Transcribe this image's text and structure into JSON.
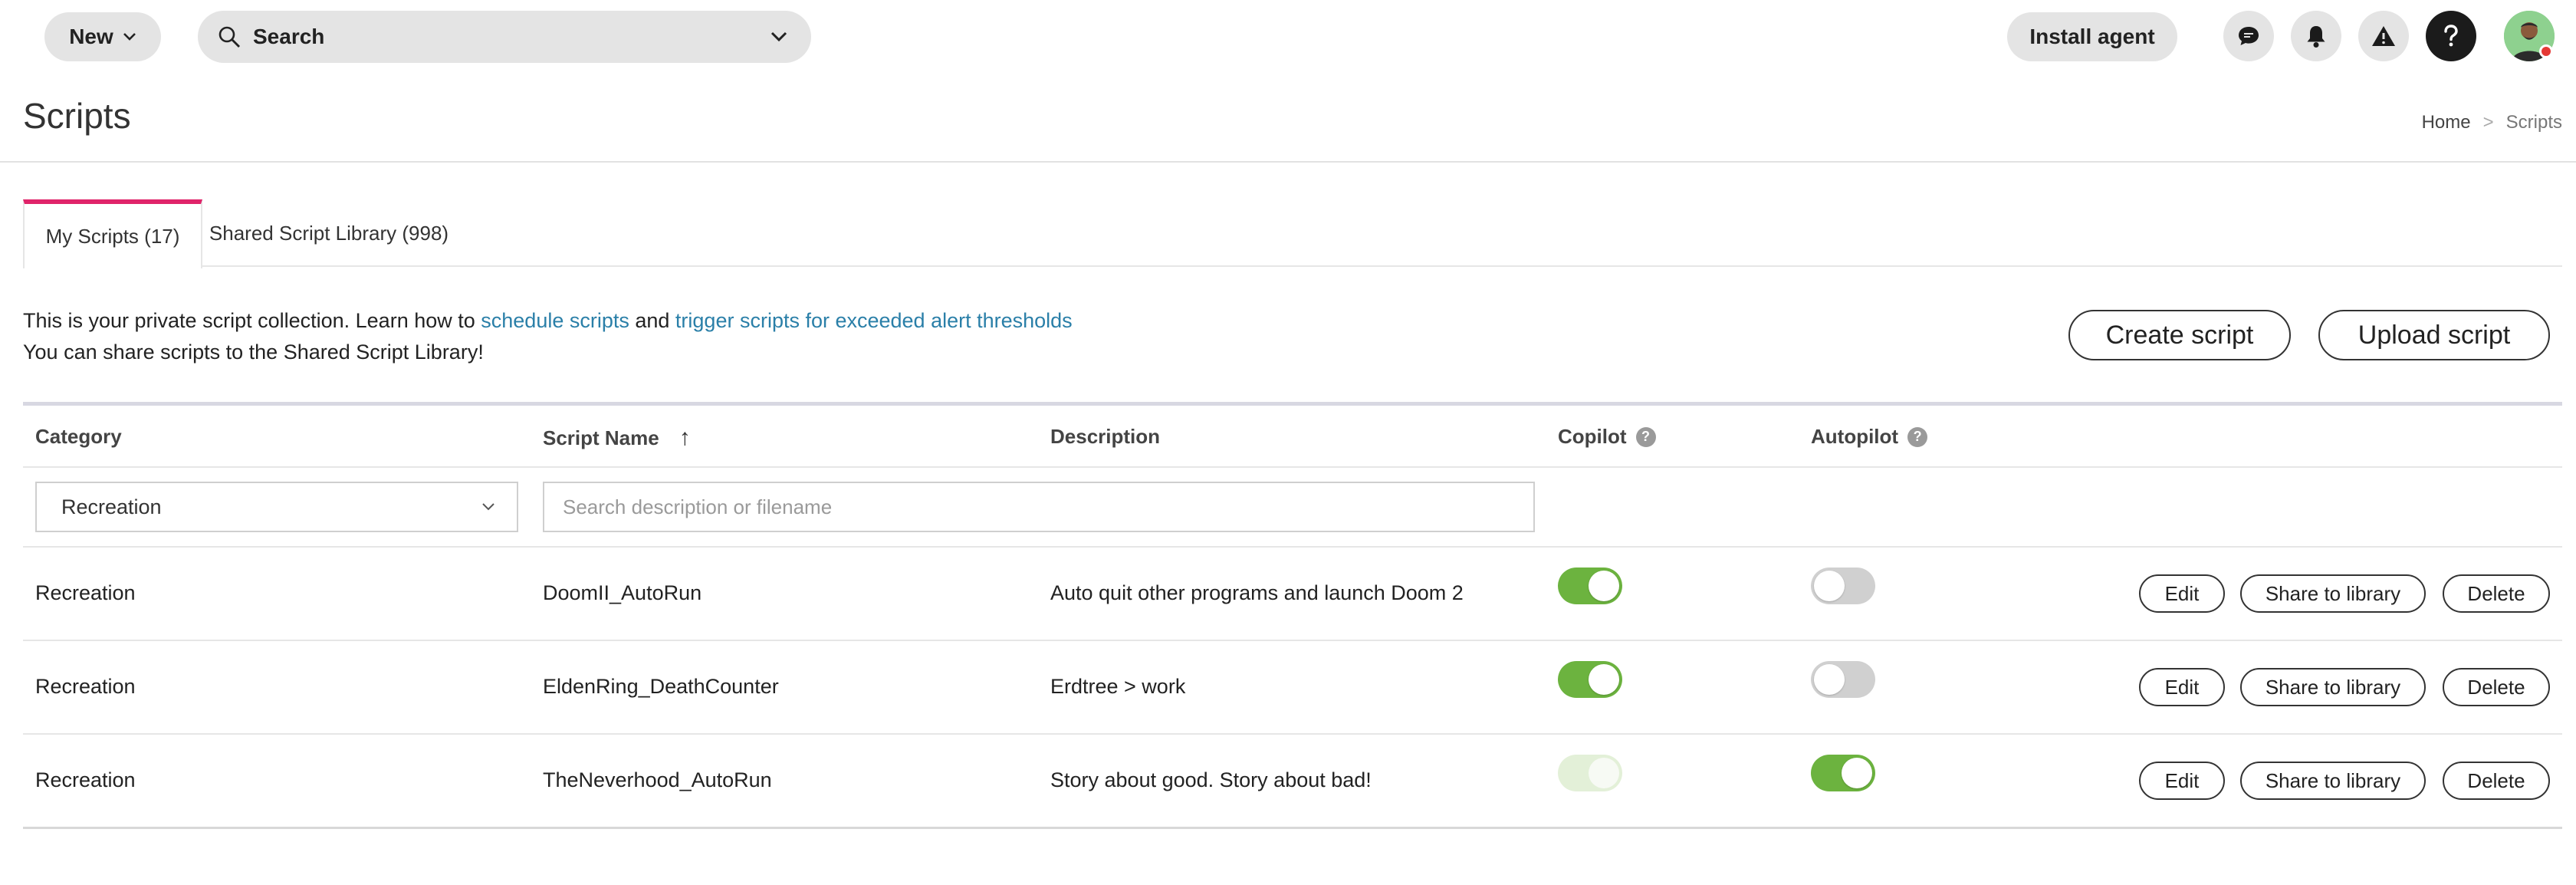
{
  "topbar": {
    "new_label": "New",
    "search_label": "Search",
    "install_label": "Install agent",
    "icons": [
      "chat-icon",
      "bell-icon",
      "warning-icon",
      "help-icon"
    ]
  },
  "header": {
    "title": "Scripts",
    "breadcrumb": {
      "home": "Home",
      "sep": ">",
      "current": "Scripts"
    }
  },
  "tabs": [
    {
      "label": "My Scripts (17)",
      "active": true
    },
    {
      "label": "Shared Script Library (998)",
      "active": false
    }
  ],
  "info": {
    "line1_prefix": "This is your private script collection. Learn how to ",
    "link1": "schedule scripts",
    "line1_mid": " and ",
    "link2": "trigger scripts for exceeded alert thresholds",
    "line2": "You can share scripts to the Shared Script Library!"
  },
  "actions": {
    "create": "Create script",
    "upload": "Upload script"
  },
  "table": {
    "headers": {
      "category": "Category",
      "name": "Script Name",
      "sort_arrow": "↑",
      "description": "Description",
      "copilot": "Copilot",
      "autopilot": "Autopilot",
      "help_glyph": "?"
    },
    "filter": {
      "category_value": "Recreation",
      "search_placeholder": "Search description or filename"
    },
    "row_buttons": {
      "edit": "Edit",
      "share": "Share to library",
      "delete": "Delete"
    },
    "rows": [
      {
        "category": "Recreation",
        "name": "DoomII_AutoRun",
        "description": "Auto quit other programs and launch Doom 2",
        "copilot": "on",
        "autopilot": "off"
      },
      {
        "category": "Recreation",
        "name": "EldenRing_DeathCounter",
        "description": "Erdtree > work",
        "copilot": "on",
        "autopilot": "off"
      },
      {
        "category": "Recreation",
        "name": "TheNeverhood_AutoRun",
        "description": "Story about good. Story about bad!",
        "copilot": "disabled",
        "autopilot": "on"
      }
    ]
  },
  "colors": {
    "accent": "#e0246a",
    "link": "#2a7fa8",
    "toggle_on": "#6cb33f"
  }
}
